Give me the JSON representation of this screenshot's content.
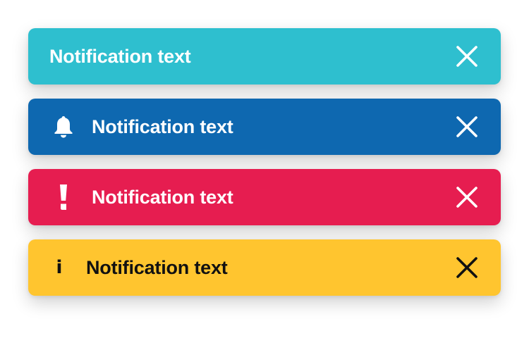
{
  "colors": {
    "teal": "#2ebfcf",
    "blue": "#0e68b0",
    "red": "#e61d50",
    "yellow": "#ffc52f",
    "light_text": "#ffffff",
    "dark_text": "#111111"
  },
  "notifications": [
    {
      "text": "Notification text",
      "icon": "none",
      "close_icon": "close-icon",
      "theme": "teal"
    },
    {
      "text": "Notification text",
      "icon": "bell-icon",
      "close_icon": "close-icon",
      "theme": "blue"
    },
    {
      "text": "Notification text",
      "icon": "exclamation-icon",
      "close_icon": "close-icon",
      "theme": "red"
    },
    {
      "text": "Notification text",
      "icon": "info-icon",
      "icon_glyph": "i",
      "close_icon": "close-icon",
      "theme": "yellow"
    }
  ]
}
